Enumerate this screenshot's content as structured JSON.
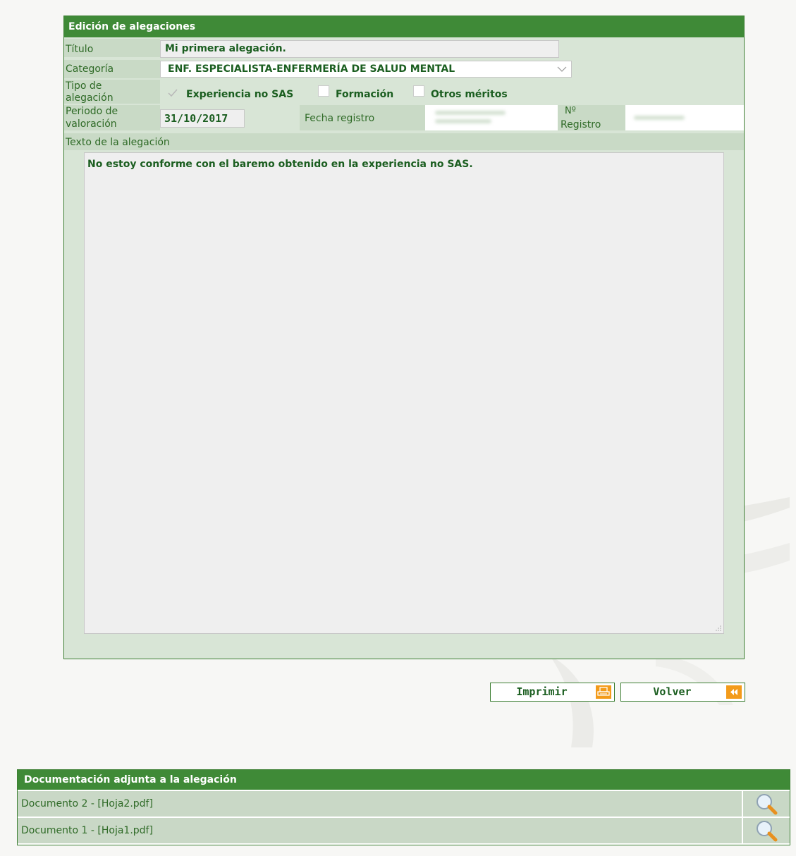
{
  "form": {
    "header": "Edición de alegaciones",
    "titulo_label": "Título",
    "titulo_value": "Mi primera alegación.",
    "categoria_label": "Categoría",
    "categoria_value": "ENF. ESPECIALISTA-ENFERMERÍA DE SALUD MENTAL",
    "tipo_label_1": "Tipo de",
    "tipo_label_2": "alegación",
    "tipos": [
      {
        "label": "Experiencia no SAS",
        "checked": true
      },
      {
        "label": "Formación",
        "checked": false
      },
      {
        "label": "Otros méritos",
        "checked": false
      }
    ],
    "periodo_label_1": "Periodo de",
    "periodo_label_2": "valoración",
    "periodo_value": "31/10/2017",
    "fecha_label": "Fecha registro",
    "registro_label_1": "Nº",
    "registro_label_2": "Registro",
    "texto_label": "Texto de la alegación",
    "texto_value": "No estoy conforme con el baremo obtenido en la experiencia no SAS."
  },
  "buttons": {
    "imprimir": "Imprimir",
    "volver": "Volver"
  },
  "docs": {
    "header": "Documentación adjunta a la alegación",
    "items": [
      {
        "name": "Documento 2 - [Hoja2.pdf]"
      },
      {
        "name": "Documento 1 - [Hoja1.pdf]"
      }
    ]
  },
  "colors": {
    "accent_green": "#3f8a37",
    "panel_bg": "#d8e5d6",
    "orange": "#f39b1a"
  }
}
